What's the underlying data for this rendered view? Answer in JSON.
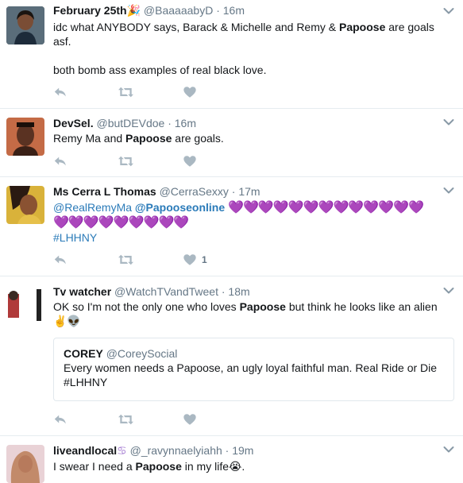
{
  "tweets": [
    {
      "name": "February 25th",
      "name_emoji": "🎉",
      "handle": "@BaaaaabyD",
      "time": "16m",
      "lines": [
        [
          {
            "t": "idc what ANYBODY says, Barack & Michelle and Remy & "
          },
          {
            "b": "Papoose"
          },
          {
            "t": " are goals"
          }
        ],
        [
          {
            "t": "asf."
          }
        ],
        [
          {
            "t": ""
          }
        ],
        [
          {
            "t": "both bomb ass examples of real black love."
          }
        ]
      ],
      "like_count": ""
    },
    {
      "name": "DevSel.",
      "handle": "@butDEVdoe",
      "time": "16m",
      "lines": [
        [
          {
            "t": "Remy Ma and "
          },
          {
            "b": "Papoose"
          },
          {
            "t": " are goals."
          }
        ]
      ],
      "like_count": ""
    },
    {
      "name": "Ms Cerra L Thomas",
      "handle": "@CerraSexxy",
      "time": "17m",
      "mention1": "@RealRemyMa",
      "mention2": "@Papooseonline",
      "hearts_line1": "💜💜💜💜💜💜💜💜💜💜💜💜💜",
      "hearts_line2": "💜💜💜💜💜💜💜💜💜",
      "hashtag": "#LHHNY",
      "like_count": "1"
    },
    {
      "name": "Tv watcher",
      "handle": "@WatchTVandTweet",
      "time": "18m",
      "line1_pre": "OK so I'm not the only one who loves ",
      "line1_bold": "Papoose",
      "line1_post": " but think he looks like an alien",
      "line2": "✌️👽",
      "quote": {
        "name": "COREY",
        "handle": "@CoreySocial",
        "line1": "Every women needs a Papoose, an ugly loyal faithful man. Real Ride or Die",
        "line2": "#LHHNY"
      },
      "like_count": ""
    },
    {
      "name": "liveandlocal",
      "name_emoji": "♋",
      "handle": "@_ravynnaelyiahh",
      "time": "19m",
      "line_pre": "I swear I need a ",
      "line_bold": "Papoose",
      "line_post": " in my life",
      "line_emoji": "😭",
      "line_end": "."
    }
  ],
  "icons": {
    "reply": "reply-icon",
    "retweet": "retweet-icon",
    "like": "heart-icon",
    "more": "chevron-down-icon"
  },
  "colors": {
    "text": "#14171a",
    "muted": "#657786",
    "link": "#2b7bb9",
    "action_icon": "#aab8c2",
    "heart_emoji": "#a77fd3"
  }
}
